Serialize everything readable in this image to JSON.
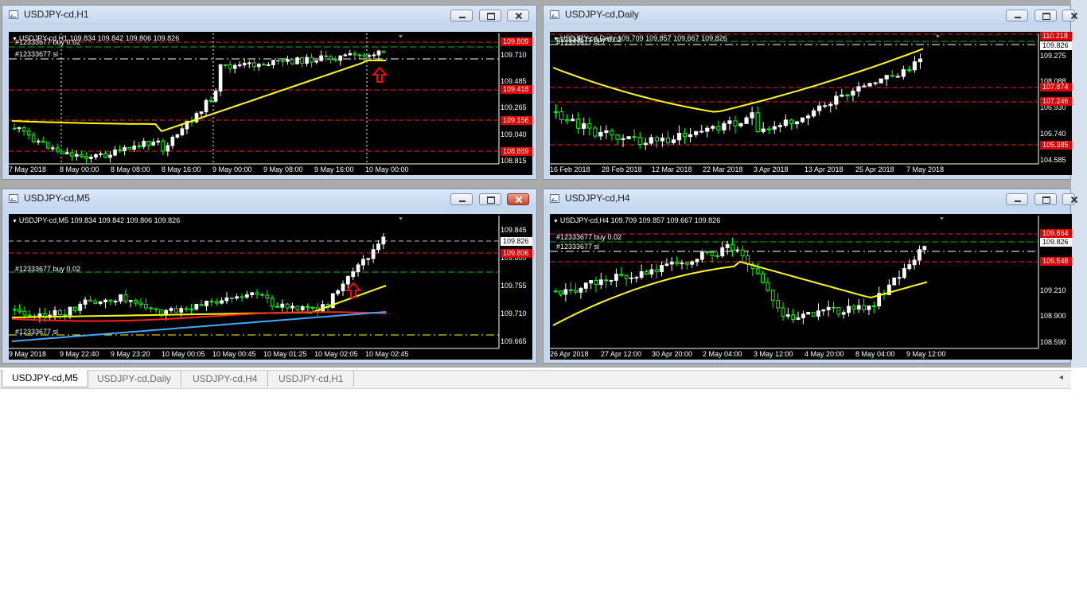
{
  "windows": [
    {
      "id": "h1",
      "title": "USDJPY-cd,H1",
      "close_active": false,
      "info": "USDJPY-cd,H1  109.834 109.842 109.806 109.826",
      "orders": [
        {
          "label": "#12333677 buy 0.02"
        },
        {
          "label": "#12333677 sl"
        }
      ],
      "price_labels": [
        "109.710",
        "109.485",
        "109.265",
        "109.040",
        "108.815"
      ],
      "price_tags": [
        {
          "text": "109.809",
          "style": "red"
        },
        {
          "text": "109.418",
          "style": "red"
        },
        {
          "text": "109.156",
          "style": "red"
        },
        {
          "text": "108.869",
          "style": "red"
        }
      ],
      "time_labels": [
        "7 May 2018",
        "8 May 00:00",
        "8 May 08:00",
        "8 May 16:00",
        "9 May 00:00",
        "9 May 08:00",
        "9 May 16:00",
        "10 May 00:00"
      ]
    },
    {
      "id": "daily",
      "title": "USDJPY-cd,Daily",
      "close_active": false,
      "info": "USDJPY-cd,Daily  109.709 109.857 109.667 109.826",
      "orders": [
        {
          "label": "#12333677 buy 0.02"
        },
        {
          "label": "#12333677 sl"
        }
      ],
      "price_labels": [
        "109.275",
        "108.088",
        "106.930",
        "105.740",
        "104.585"
      ],
      "price_tags": [
        {
          "text": "110.218",
          "style": "red"
        },
        {
          "text": "109.826",
          "style": "white"
        },
        {
          "text": "107.874",
          "style": "red"
        },
        {
          "text": "107.246",
          "style": "red"
        },
        {
          "text": "105.385",
          "style": "red"
        }
      ],
      "time_labels": [
        "16 Feb 2018",
        "28 Feb 2018",
        "12 Mar 2018",
        "22 Mar 2018",
        "3 Apr 2018",
        "13 Apr 2018",
        "25 Apr 2018",
        "7 May 2018"
      ]
    },
    {
      "id": "m5",
      "title": "USDJPY-cd,M5",
      "close_active": true,
      "info": "USDJPY-cd,M5  109.834 109.842 109.806 109.826",
      "orders": [
        {
          "label": "#12333677 buy 0.02"
        },
        {
          "label": "#12333677 sl"
        }
      ],
      "price_labels": [
        "109.845",
        "109.800",
        "109.755",
        "109.710",
        "109.665"
      ],
      "price_tags": [
        {
          "text": "109.826",
          "style": "white"
        },
        {
          "text": "109.806",
          "style": "red"
        }
      ],
      "time_labels": [
        "9 May 2018",
        "9 May 22:40",
        "9 May 23:20",
        "10 May 00:05",
        "10 May 00:45",
        "10 May 01:25",
        "10 May 02:05",
        "10 May 02:45"
      ]
    },
    {
      "id": "h4",
      "title": "USDJPY-cd,H4",
      "close_active": false,
      "info": "USDJPY-cd,H4  109.709 109.857 109.667 109.826",
      "orders": [
        {
          "label": "#12333677 buy 0.02"
        },
        {
          "label": "#12333677 sl"
        }
      ],
      "price_labels": [
        "109.210",
        "108.900",
        "108.590"
      ],
      "price_tags": [
        {
          "text": "109.864",
          "style": "red"
        },
        {
          "text": "109.826",
          "style": "white"
        },
        {
          "text": "109.548",
          "style": "red"
        }
      ],
      "time_labels": [
        "26 Apr 2018",
        "27 Apr 12:00",
        "30 Apr 20:00",
        "2 May 04:00",
        "3 May 12:00",
        "4 May 20:00",
        "8 May 04:00",
        "9 May 12:00"
      ]
    }
  ],
  "tabs": [
    {
      "label": "USDJPY-cd,M5",
      "active": true
    },
    {
      "label": "USDJPY-cd,Daily",
      "active": false
    },
    {
      "label": "USDJPY-cd,H4",
      "active": false
    },
    {
      "label": "USDJPY-cd,H1",
      "active": false
    }
  ],
  "colors": {
    "background": "#000000",
    "bull": "#ffffff",
    "bear": "#00ff00",
    "ma_yellow": "#ffff00",
    "ma_red": "#ff2020",
    "ma_blue": "#3fa9ff",
    "level_red": "#ff2020",
    "order_green": "#00c000",
    "arrow": "#ff0000"
  },
  "icons": [
    "chart-window-icon",
    "minimize-icon",
    "maximize-icon",
    "close-icon",
    "arrow-up-icon"
  ]
}
